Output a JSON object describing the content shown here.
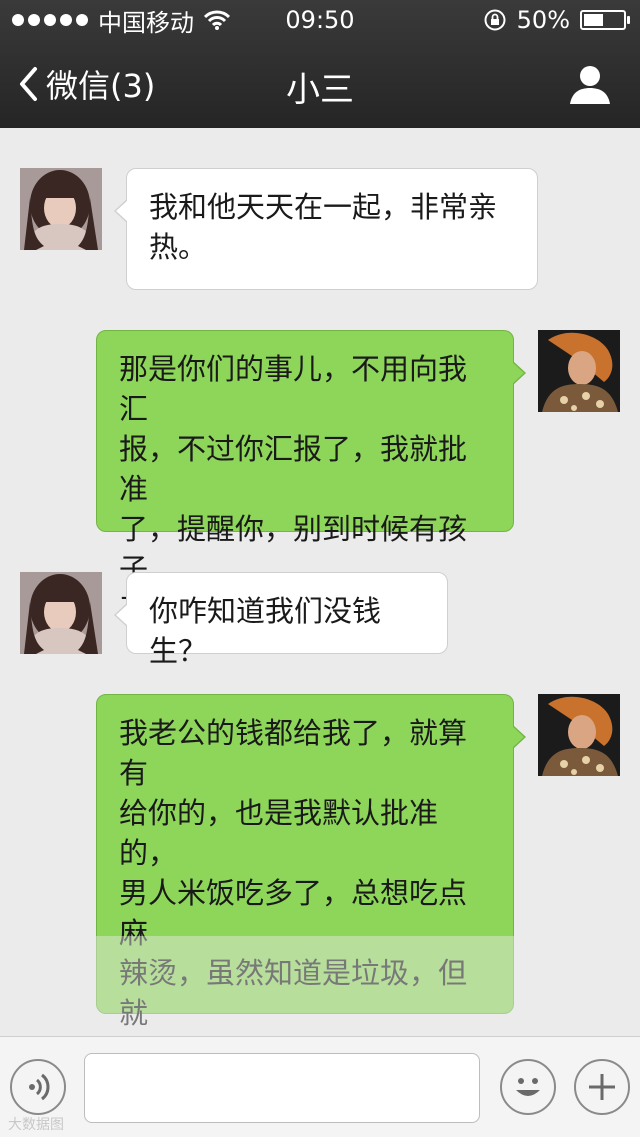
{
  "status_bar": {
    "carrier": "中国移动",
    "time": "09:50",
    "battery_percent": "50%",
    "battery_level": 0.5
  },
  "nav": {
    "back_label": "微信(3)",
    "title": "小三"
  },
  "messages": [
    {
      "direction": "in",
      "text": "我和他天天在一起，非常亲\n热。"
    },
    {
      "direction": "out",
      "text": "那是你们的事儿，不用向我汇\n报，不过你汇报了，我就批准\n了，提醒你，别到时候有孩子\n了没钱生啊 。"
    },
    {
      "direction": "in",
      "text": "你咋知道我们没钱生？"
    },
    {
      "direction": "out",
      "text": "我老公的钱都给我了，就算有\n给你的，也是我默认批准的，\n男人米饭吃多了，总想吃点麻\n辣烫，虽然知道是垃圾，但就\n是管不住自己，我总得给他点\n吃垃圾的钱吧，再说，你真以\n为他愿意和你生孩子啊！"
    }
  ],
  "input_bar": {
    "text_value": ""
  },
  "watermark": "大数据图",
  "icons": {
    "back": "chevron-left-icon",
    "profile": "person-icon",
    "wifi": "wifi-icon",
    "lock": "rotation-lock-icon",
    "voice": "voice-icon",
    "emoji": "emoji-icon",
    "plus": "plus-icon"
  },
  "colors": {
    "nav_bg": "#2e2e2e",
    "chat_bg": "#ebebeb",
    "bubble_out": "#8dd65a",
    "bubble_in": "#ffffff"
  }
}
